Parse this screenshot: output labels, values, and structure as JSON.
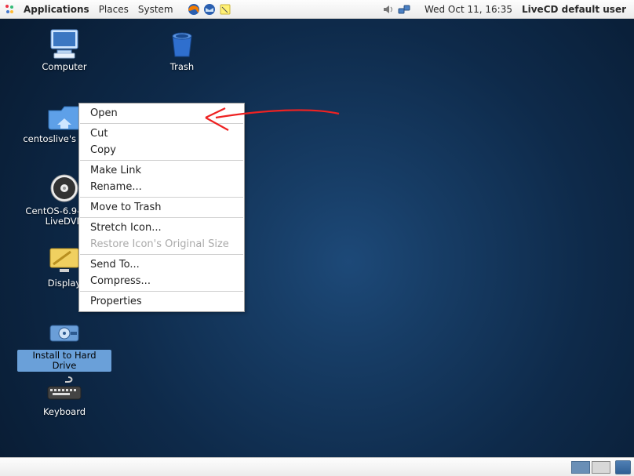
{
  "panel": {
    "menu_applications": "Applications",
    "menu_places": "Places",
    "menu_system": "System",
    "clock": "Wed Oct 11, 16:35",
    "user": "LiveCD default user"
  },
  "icons": {
    "computer": "Computer",
    "trash": "Trash",
    "home": "centoslive's Home",
    "dvd": "CentOS-6.9-i386-LiveDVD",
    "display": "Display",
    "install": "Install to Hard Drive",
    "keyboard": "Keyboard"
  },
  "context_menu": {
    "open": "Open",
    "cut": "Cut",
    "copy": "Copy",
    "make_link": "Make Link",
    "rename": "Rename...",
    "move_to_trash": "Move to Trash",
    "stretch_icon": "Stretch Icon...",
    "restore_icon": "Restore Icon's Original Size",
    "send_to": "Send To...",
    "compress": "Compress...",
    "properties": "Properties"
  }
}
